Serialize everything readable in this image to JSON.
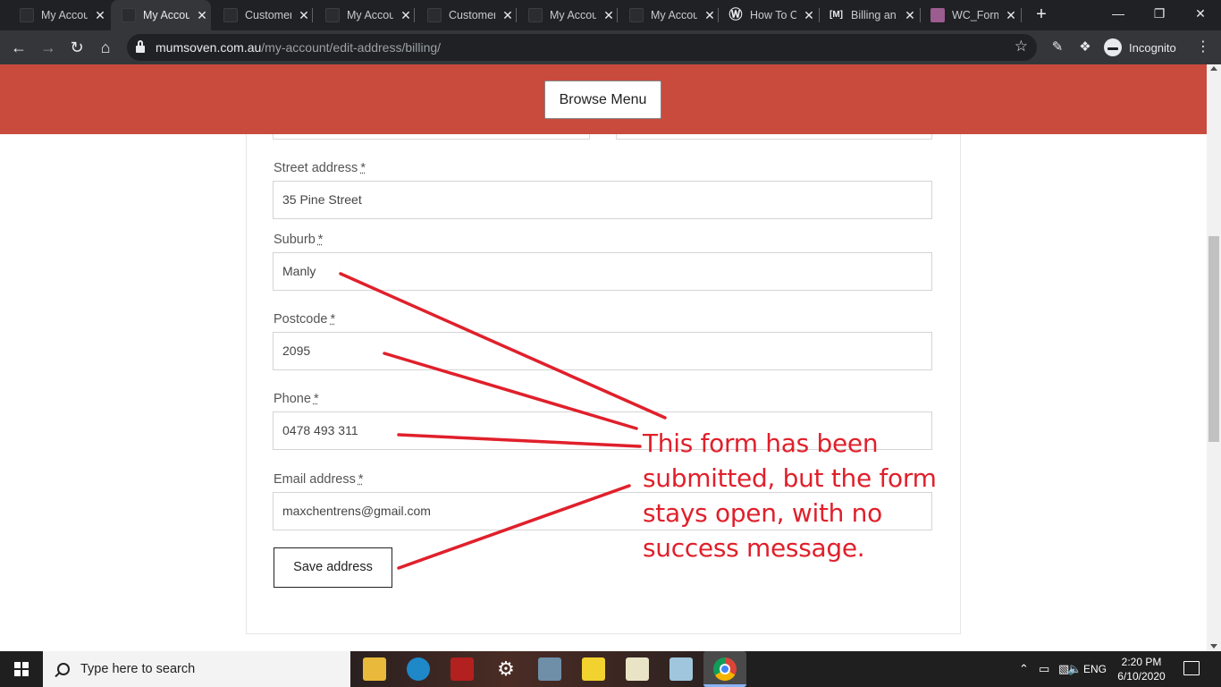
{
  "browser": {
    "tabs": [
      {
        "title": "My Account",
        "active": false,
        "favicon": "page-icon"
      },
      {
        "title": "My Account",
        "active": true,
        "favicon": "page-icon"
      },
      {
        "title": "Customer",
        "active": false,
        "favicon": "page-icon"
      },
      {
        "title": "My Account",
        "active": false,
        "favicon": "page-icon"
      },
      {
        "title": "Customer",
        "active": false,
        "favicon": "page-icon"
      },
      {
        "title": "My Account",
        "active": false,
        "favicon": "page-icon"
      },
      {
        "title": "My Account",
        "active": false,
        "favicon": "page-icon"
      },
      {
        "title": "How To C",
        "active": false,
        "favicon": "wordpress-icon"
      },
      {
        "title": "Billing an",
        "active": false,
        "favicon": "m-icon"
      },
      {
        "title": "WC_Form",
        "active": false,
        "favicon": "woo-icon"
      }
    ],
    "new_tab_glyph": "+",
    "url_host": "mumsoven.com.au",
    "url_path": "/my-account/edit-address/billing/",
    "profile_label": "Incognito"
  },
  "page": {
    "header": {
      "browse_menu_label": "Browse Menu",
      "background_color": "#c84b3e"
    },
    "form": {
      "required_marker": "*",
      "fields": [
        {
          "label": "Street address",
          "value": "35 Pine Street"
        },
        {
          "label": "Suburb",
          "value": "Manly"
        },
        {
          "label": "Postcode",
          "value": "2095"
        },
        {
          "label": "Phone",
          "value": "0478 493 311"
        },
        {
          "label": "Email address",
          "value": "maxchentrens@gmail.com"
        }
      ],
      "submit_label": "Save address"
    },
    "annotation": {
      "text": "This form has been submitted, but the form stays open, with no success message.",
      "color": "#e0202b"
    }
  },
  "taskbar": {
    "search_placeholder": "Type here to search",
    "language": "ENG",
    "time": "2:20 PM",
    "date": "6/10/2020",
    "pinned_apps": [
      "file-explorer-icon",
      "app-icon",
      "filezilla-icon",
      "settings-icon",
      "calculator-icon",
      "sticky-notes-icon",
      "tasks-icon",
      "app-icon",
      "chrome-icon"
    ]
  }
}
